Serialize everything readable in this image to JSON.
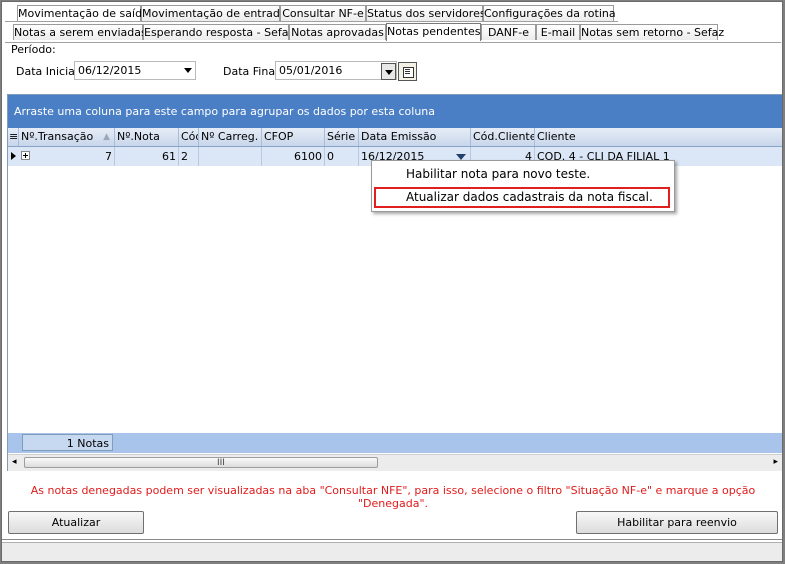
{
  "tabs_top": [
    {
      "label": "Movimentação de saída"
    },
    {
      "label": "Movimentação de entrada"
    },
    {
      "label": "Consultar NF-e"
    },
    {
      "label": "Status dos servidores"
    },
    {
      "label": "Configurações da rotina"
    }
  ],
  "tabs_sub": [
    {
      "label": "Notas a serem enviadas"
    },
    {
      "label": "Esperando resposta - Sefaz"
    },
    {
      "label": "Notas aprovadas"
    },
    {
      "label": "Notas pendentes"
    },
    {
      "label": "DANF-e"
    },
    {
      "label": "E-mail"
    },
    {
      "label": "Notas sem retorno - Sefaz"
    }
  ],
  "period": {
    "title": "Período:",
    "start_label": "Data Inicial",
    "start_value": "06/12/2015",
    "end_label": "Data Final",
    "end_value": "05/01/2016"
  },
  "grid": {
    "group_hint": "Arraste uma coluna para este campo para agrupar os dados por esta coluna",
    "columns": [
      "Nº.Transação",
      "Nº.Nota",
      "Cód",
      "Nº Carreg.",
      "CFOP",
      "Série",
      "Data Emissão",
      "Cód.Cliente",
      "Cliente"
    ],
    "row": {
      "transacao": "7",
      "nota": "61",
      "cod": "2",
      "carreg": "",
      "cfop": "6100",
      "serie": "0",
      "emissao": "16/12/2015",
      "cod_cliente": "4",
      "cliente": "COD. 4 - CLI DA FILIAL 1"
    },
    "count_label": "1 Notas",
    "scroll_grip": "III"
  },
  "context_menu": {
    "item1": "Habilitar nota para novo teste.",
    "item2": "Atualizar dados cadastrais da nota fiscal."
  },
  "notice": "As notas denegadas podem ser visualizadas na aba \"Consultar NFE\", para isso, selecione o filtro \"Situação NF-e\" e marque a opção \"Denegada\".",
  "buttons": {
    "refresh": "Atualizar",
    "resend": "Habilitar para reenvio"
  },
  "colors": {
    "accent": "#4a7fc5",
    "notice": "#e21b1b",
    "highlight": "#e01f1f"
  }
}
